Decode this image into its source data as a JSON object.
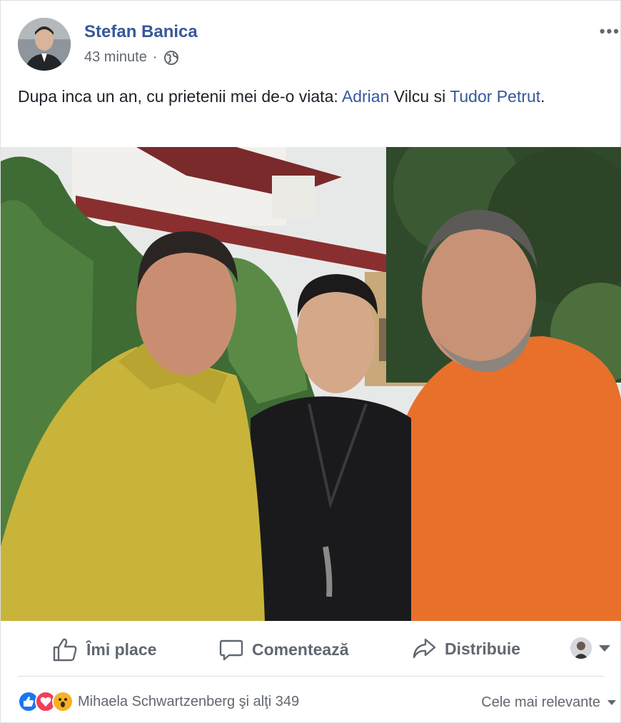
{
  "post": {
    "author": "Stefan Banica",
    "time": "43 minute",
    "separator": "·",
    "privacy_icon": "globe-icon",
    "more_label": "•••",
    "text_before": "Dupa inca un an, cu prietenii mei de-o viata: ",
    "mention_1": "Adrian",
    "text_mid": " Vilcu si ",
    "mention_2": "Tudor Petrut",
    "text_end": "."
  },
  "actions": {
    "like_label": "Îmi place",
    "comment_label": "Comentează",
    "share_label": "Distribuie"
  },
  "reactions": {
    "icons": [
      "like-icon",
      "love-icon",
      "wow-icon"
    ],
    "summary": "Mihaela Schwartzenberg şi alţi 349"
  },
  "comments": {
    "sort_label": "Cele mai relevante"
  },
  "colors": {
    "link": "#365899",
    "like": "#1877f2",
    "love": "#f33e58",
    "wow": "#f7b125"
  }
}
